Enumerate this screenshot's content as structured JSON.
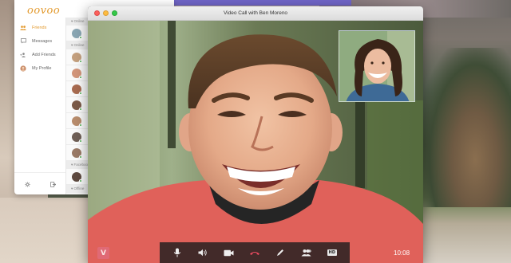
{
  "app": {
    "logo_text": "oovoo",
    "nav": [
      {
        "label": "Friends",
        "icon": "friends-icon",
        "active": true
      },
      {
        "label": "Messages",
        "icon": "messages-icon",
        "active": false
      },
      {
        "label": "Add Friends",
        "icon": "add-friends-icon",
        "active": false
      },
      {
        "label": "My Profile",
        "icon": "profile-icon",
        "active": false
      }
    ],
    "sections": {
      "online": "Online",
      "facebook": "Facebook",
      "offline": "Offline"
    },
    "footer_icons": [
      "settings-icon",
      "logout-icon"
    ]
  },
  "call": {
    "window_title": "Video Call with Ben Moreno",
    "timer": "10:08",
    "brand_letter": "V",
    "hd_label": "HD",
    "controls": [
      "microphone-icon",
      "speaker-icon",
      "camera-icon",
      "hang-up-icon",
      "pen-icon",
      "add-participant-icon",
      "hd-icon"
    ]
  },
  "colors": {
    "accent": "#e39a2e",
    "hang_up": "#e84a5f",
    "online_dot": "#4caf50"
  }
}
